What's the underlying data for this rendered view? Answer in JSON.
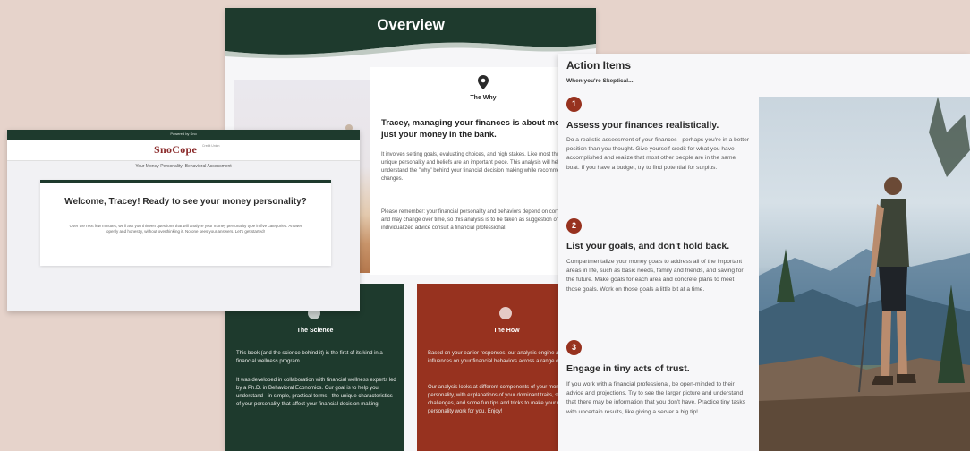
{
  "overview": {
    "title": "Overview",
    "why": {
      "label": "The Why",
      "lead": "Tracey, managing your finances is about more than just your money in the bank.",
      "p1": "It involves setting goals, evaluating choices, and high stakes. Like most things in life, your unique personality and beliefs are an important piece. This analysis will help you better understand the \"why\" behind your financial decision making while recommending positive changes.",
      "p2": "Please remember: your financial personality and behaviors depend on complex factors and may change over time, so this analysis is to be taken as suggestion only. For individualized advice consult a financial professional."
    },
    "science": {
      "title": "The Science",
      "p1": "This book (and the science behind it) is the first of its kind in a financial wellness program.",
      "p2": "It was developed in collaboration with financial wellness experts led by a Ph.D. in Behavioral Economics. Our goal is to help you understand - in simple, practical terms - the unique characteristics of your personality that affect your financial decision making."
    },
    "how": {
      "title": "The How",
      "p1": "Based on your earlier responses, our analysis engine assessed the influences on your financial behaviors across a range of categories.",
      "p2": "Our analysis looks at different components of your money personality, with explanations of your dominant traits, strengths, challenges, and some fun tips and tricks to make your money personality work for you. Enjoy!"
    }
  },
  "welcome": {
    "topbar": "Powered by Sno",
    "logo": "SnoCope",
    "logo_sub": "Credit Union",
    "subtitle": "Your Money Personality: Behavioral Assessment",
    "heading": "Welcome, Tracey! Ready to see your money personality?",
    "body": "Over the next few minutes, we'll ask you thirteen questions that will analyze your money personality type in five categories. Answer openly and honestly, without overthinking it. No one sees your answers. Let's get started!"
  },
  "actions": {
    "title": "Action Items",
    "subtitle": "When you're Skeptical...",
    "items": [
      {
        "num": "1",
        "heading": "Assess your finances realistically.",
        "body": "Do a realistic assessment of your finances - perhaps you're in a better position than you thought. Give yourself credit for what you have accomplished and realize that most other people are in the same boat. If you have a budget, try to find potential for surplus."
      },
      {
        "num": "2",
        "heading": "List your goals, and don't hold back.",
        "body": "Compartmentalize your money goals to address all of the important areas in life, such as basic needs, family and friends, and saving for the future. Make goals for each area and concrete plans to meet those goals. Work on those goals a little bit at a time."
      },
      {
        "num": "3",
        "heading": "Engage in tiny acts of trust.",
        "body": "If you work with a financial professional, be open-minded to their advice and projections. Try to see the larger picture and understand that there may be information that you don't have. Practice tiny tasks with uncertain results, like giving a server a big tip!"
      }
    ]
  },
  "colors": {
    "dark_green": "#1e3a2d",
    "rust": "#97321f",
    "background": "#e6d3cb"
  }
}
